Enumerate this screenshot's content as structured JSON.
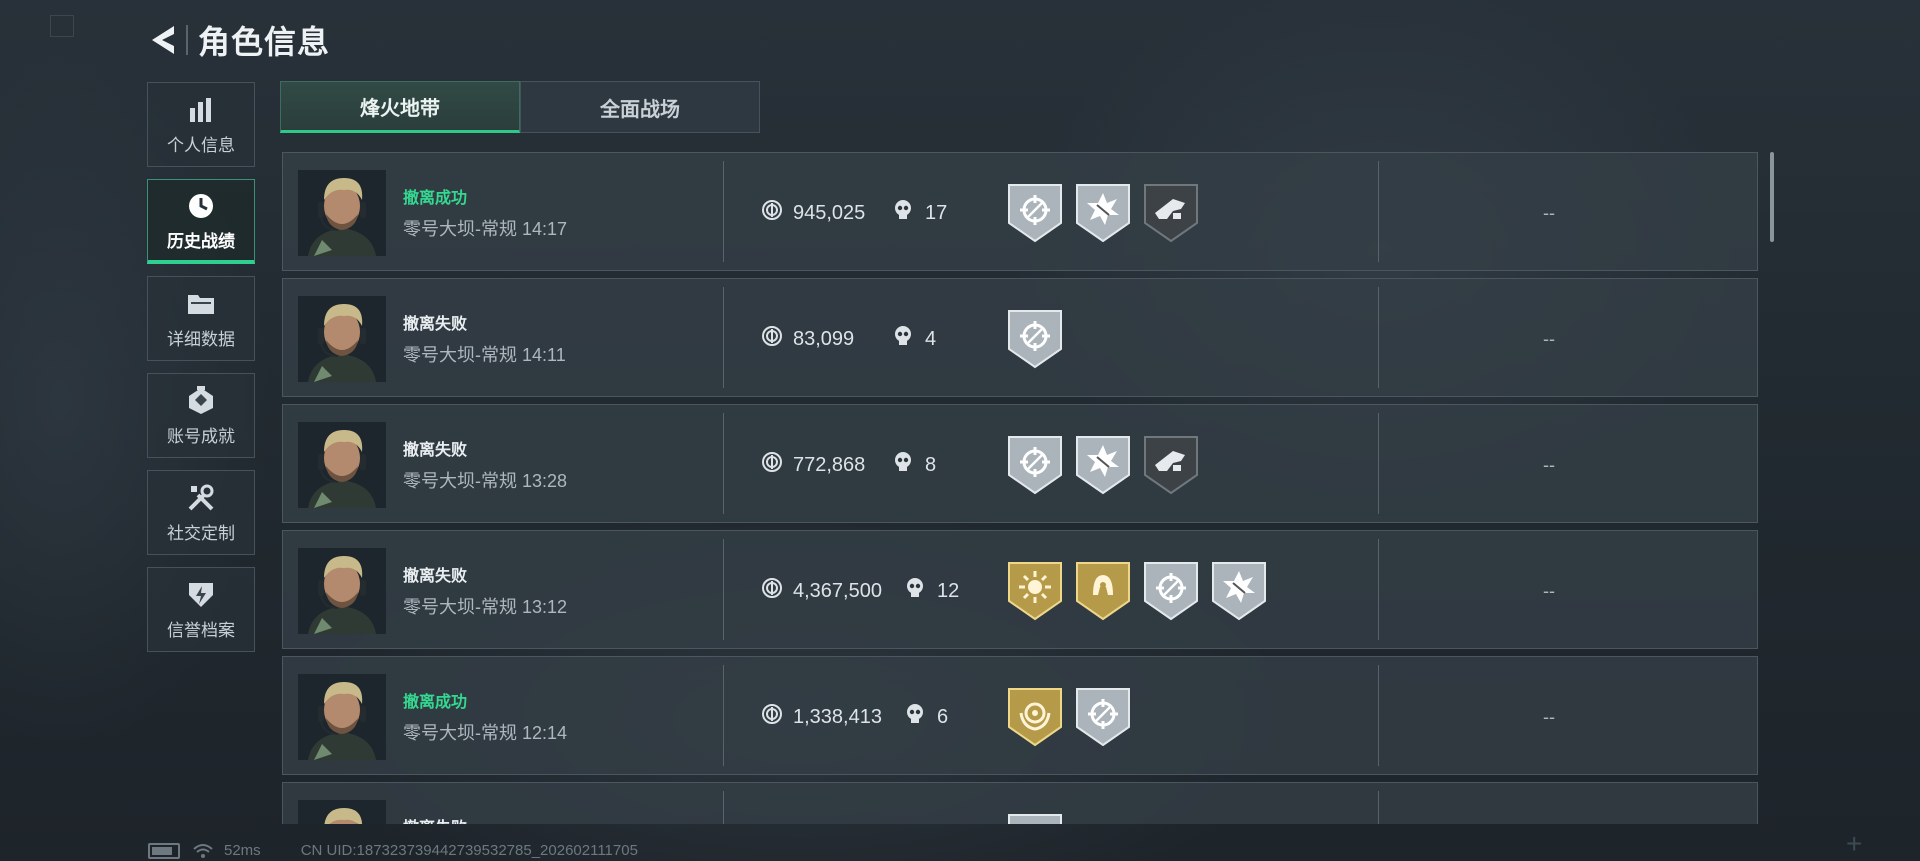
{
  "header": {
    "title": "角色信息"
  },
  "sidebar": {
    "items": [
      {
        "label": "个人信息",
        "icon": "bar-chart-icon"
      },
      {
        "label": "历史战绩",
        "icon": "clock-icon",
        "active": true
      },
      {
        "label": "详细数据",
        "icon": "folder-icon"
      },
      {
        "label": "账号成就",
        "icon": "achievement-icon"
      },
      {
        "label": "社交定制",
        "icon": "tools-icon"
      },
      {
        "label": "信誉档案",
        "icon": "shield-bolt-icon"
      }
    ]
  },
  "tabs": [
    {
      "label": "烽火地带",
      "active": true
    },
    {
      "label": "全面战场",
      "active": false
    }
  ],
  "matches": [
    {
      "status": "撤离成功",
      "success": true,
      "map": "零号大坝-常规",
      "time": "14:17",
      "value": "945,025",
      "kills": "17",
      "medals": [
        "crosshair-silver",
        "burst-silver",
        "gun-dark"
      ],
      "extra": "--"
    },
    {
      "status": "撤离失败",
      "success": false,
      "map": "零号大坝-常规",
      "time": "14:11",
      "value": "83,099",
      "kills": "4",
      "medals": [
        "crosshair-silver"
      ],
      "extra": "--"
    },
    {
      "status": "撤离失败",
      "success": false,
      "map": "零号大坝-常规",
      "time": "13:28",
      "value": "772,868",
      "kills": "8",
      "medals": [
        "crosshair-silver",
        "burst-silver",
        "gun-dark"
      ],
      "extra": "--"
    },
    {
      "status": "撤离失败",
      "success": false,
      "map": "零号大坝-常规",
      "time": "13:12",
      "value": "4,367,500",
      "kills": "12",
      "medals": [
        "sun-gold",
        "helmet-gold",
        "crosshair-silver",
        "burst-silver"
      ],
      "extra": "--"
    },
    {
      "status": "撤离成功",
      "success": true,
      "map": "零号大坝-常规",
      "time": "12:14",
      "value": "1,338,413",
      "kills": "6",
      "medals": [
        "wreath-gold",
        "crosshair-silver"
      ],
      "extra": "--"
    },
    {
      "status": "撤离失败",
      "success": false,
      "map": "",
      "time": "",
      "value": "",
      "kills": "",
      "medals": [
        "crosshair-silver"
      ],
      "extra": ""
    }
  ],
  "footer": {
    "ping": "52ms",
    "uid": "CN UID:18732373944273953278​5_202602111705"
  }
}
